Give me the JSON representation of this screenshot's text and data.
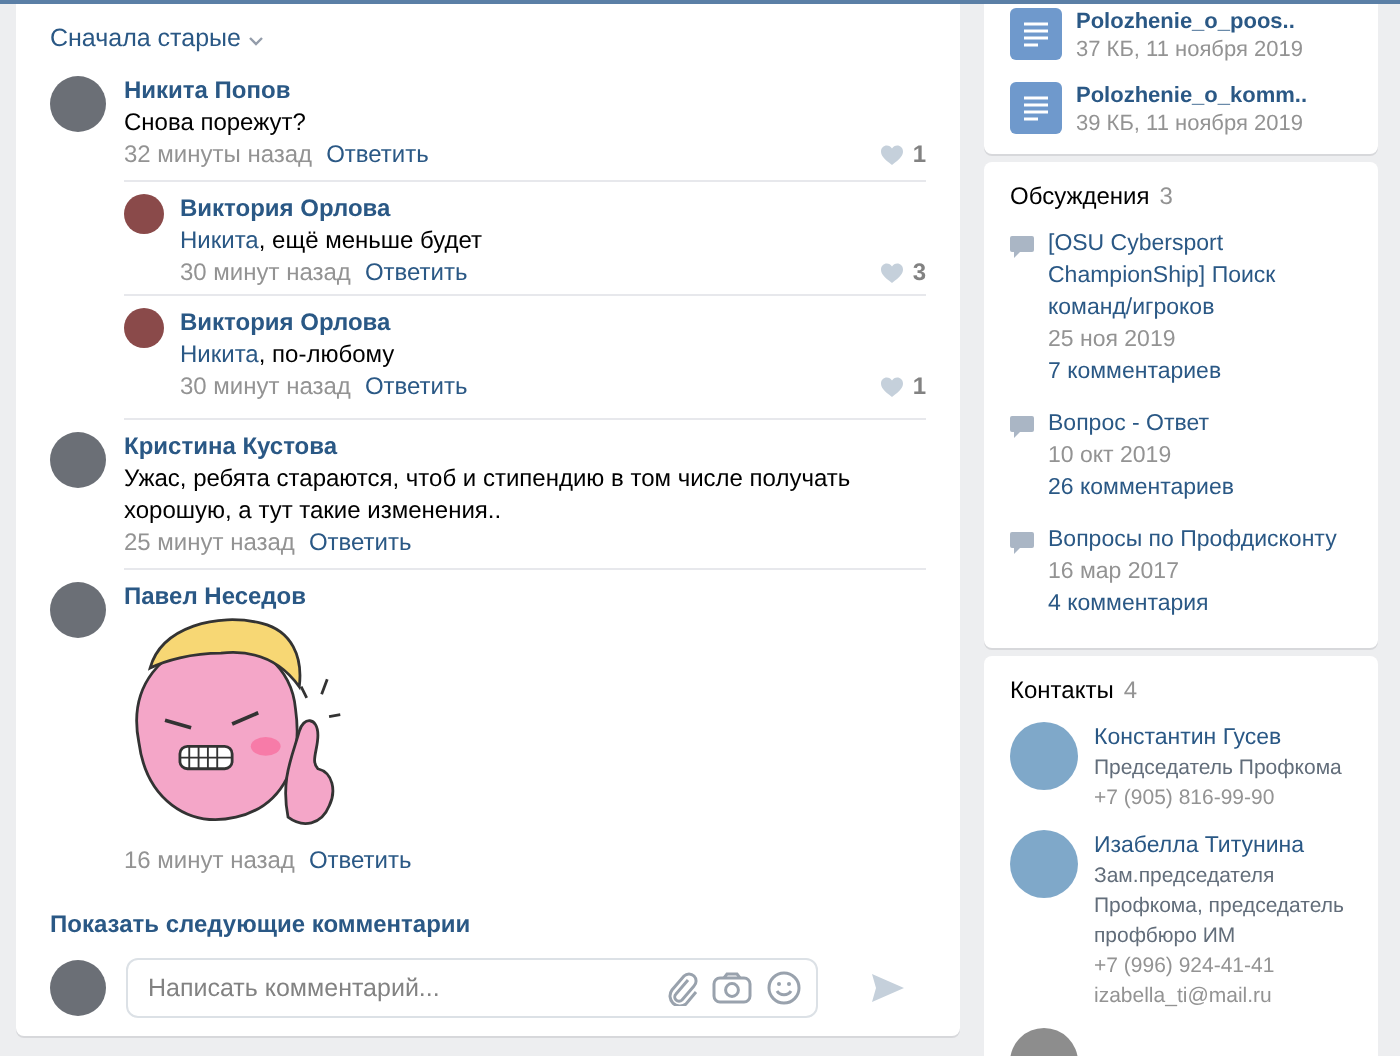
{
  "sort": {
    "label": "Сначала старые"
  },
  "comments": [
    {
      "kind": "text",
      "author": "Никита Попов",
      "text": "Снова порежут?",
      "time": "32 минуты назад",
      "reply": "Ответить",
      "likes": "1",
      "children": [
        {
          "kind": "text",
          "author": "Виктория Орлова",
          "text": "**Никита**, ещё меньше будет",
          "time": "30 минут назад",
          "reply": "Ответить",
          "likes": "3"
        },
        {
          "kind": "text",
          "author": "Виктория Орлова",
          "text": "**Никита**, по-любому",
          "time": "30 минут назад",
          "reply": "Ответить",
          "likes": "1"
        }
      ]
    },
    {
      "kind": "text",
      "author": "Кристина Кустова",
      "text": "Ужас, ребята стараются, чтоб и стипендию в том числе получать хорошую, а тут такие изменения..",
      "time": "25 минут назад",
      "reply": "Ответить"
    },
    {
      "kind": "sticker",
      "author": "Павел Неседов",
      "time": "16 минут назад",
      "reply": "Ответить"
    }
  ],
  "show_more": "Показать следующие комментарии",
  "composer": {
    "placeholder": "Написать комментарий..."
  },
  "documents": [
    {
      "name": "Polozhenie_o_poos..",
      "meta": "37 КБ, 11 ноября 2019"
    },
    {
      "name": "Polozhenie_o_komm..",
      "meta": "39 КБ, 11 ноября 2019"
    }
  ],
  "discussions": {
    "title": "Обсуждения",
    "count": "3",
    "items": [
      {
        "title": "[OSU Cybersport ChampionShip] Поиск команд/игроков",
        "date": "25 ноя 2019",
        "comments": "7 комментариев"
      },
      {
        "title": "Вопрос - Ответ",
        "date": "10 окт 2019",
        "comments": "26 комментариев"
      },
      {
        "title": "Вопросы по Профдисконту",
        "date": "16 мар 2017",
        "comments": "4 комментария"
      }
    ]
  },
  "contacts": {
    "title": "Контакты",
    "count": "4",
    "items": [
      {
        "name": "Константин Гусев",
        "role": "Председатель Профкома",
        "phone": "+7 (905) 816-99-90"
      },
      {
        "name": "Изабелла Титунина",
        "role": "Зам.председателя Профкома, председатель профбюро ИМ",
        "phone": "+7 (996) 924-41-41",
        "email": "izabella_ti@mail.ru"
      }
    ]
  }
}
